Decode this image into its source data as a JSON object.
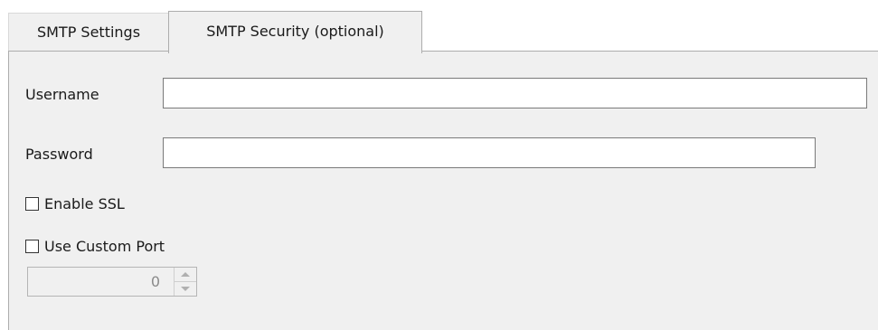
{
  "tabs": [
    {
      "label": "SMTP Settings",
      "active": false
    },
    {
      "label": "SMTP Security (optional)",
      "active": true
    }
  ],
  "form": {
    "username_label": "Username",
    "username_value": "",
    "password_label": "Password",
    "password_value": "",
    "enable_ssl": {
      "label": "Enable SSL",
      "checked": false
    },
    "use_custom_port": {
      "label": "Use Custom Port",
      "checked": false
    },
    "port_value": "0"
  },
  "icons": {
    "spin_up": "triangle-up-icon",
    "spin_down": "triangle-down-icon"
  }
}
